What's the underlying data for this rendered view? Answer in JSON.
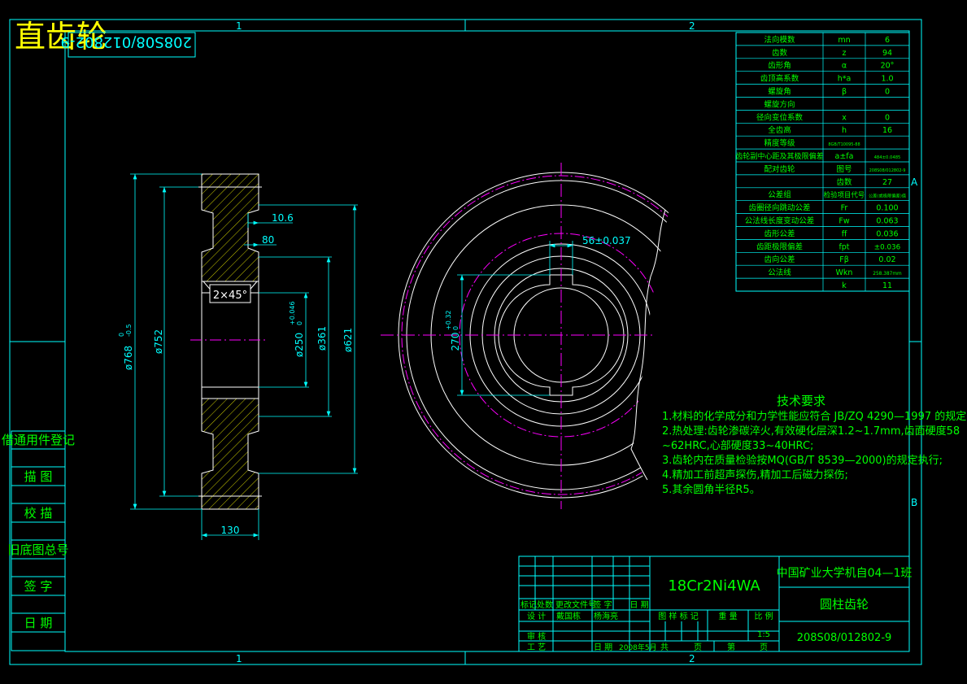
{
  "drawing": {
    "title_text": "直齿轮",
    "drawing_number_rotated": "208S08/012802-9",
    "zone_labels": {
      "col1": "1",
      "col2": "2",
      "rowA": "A",
      "rowB": "B"
    }
  },
  "colors": {
    "frame": "#00ffff",
    "geometry": "#ffffff",
    "center": "#ff00ff",
    "dimension": "#00ffff",
    "hatch": "#ffff00",
    "text_green": "#00ff00",
    "title": "#ffff00"
  },
  "side_panel": {
    "items": [
      "借通用件登记",
      "描 图",
      "校 描",
      "旧底图总号",
      "签 字",
      "日 期"
    ]
  },
  "dimensions": {
    "d_tip": "ø768",
    "d_tip_tol_upper": "0",
    "d_tip_tol_lower": "-0.5",
    "d_root": "ø752",
    "d_bore": "ø250",
    "d_bore_tol_upper": "+0.046",
    "d_bore_tol_lower": "0",
    "d_hub": "ø361",
    "d_web": "ø621",
    "width": "130",
    "groove_10": "10.6",
    "groove_80": "80",
    "chamfer": "2×45°",
    "keyway_width": "56±0.037",
    "keyway_depth": "270",
    "keyway_depth_tol_upper": "+0.32",
    "keyway_depth_tol_lower": "0"
  },
  "param_table": {
    "rows": [
      [
        "法向模数",
        "mn",
        "6"
      ],
      [
        "齿数",
        "z",
        "94"
      ],
      [
        "齿形角",
        "α",
        "20°"
      ],
      [
        "齿顶高系数",
        "h*a",
        "1.0"
      ],
      [
        "螺旋角",
        "β",
        "0"
      ],
      [
        "螺旋方向",
        "",
        ""
      ],
      [
        "径向变位系数",
        "x",
        "0"
      ],
      [
        "全齿高",
        "h",
        "16"
      ],
      [
        "精度等级",
        "8GB/T10095-88",
        ""
      ],
      [
        "齿轮副中心距及其极限偏差",
        "a±fa",
        "484±0.0485"
      ],
      [
        "配对齿轮",
        "图号",
        "208S08/012802-9"
      ],
      [
        "",
        "齿数",
        "27"
      ],
      [
        "公差组",
        "检验项目代号",
        "公差(或极限偏差)值"
      ],
      [
        "齿圈径向跳动公差",
        "Fr",
        "0.100"
      ],
      [
        "公法线长度变动公差",
        "Fw",
        "0.063"
      ],
      [
        "齿形公差",
        "ff",
        "0.036"
      ],
      [
        "齿距极限偏差",
        "fpt",
        "±0.036"
      ],
      [
        "齿向公差",
        "Fβ",
        "0.02"
      ],
      [
        "公法线",
        "Wkn",
        "258.387mm"
      ],
      [
        "",
        "k",
        "11"
      ]
    ]
  },
  "tech_requirements": {
    "title": "技术要求",
    "lines": [
      "1.材料的化学成分和力学性能应符合 JB/ZQ 4290—1997 的规定;",
      "2.热处理:齿轮渗碳淬火,有效硬化层深1.2~1.7mm,齿面硬度58",
      "  ~62HRC,心部硬度33~40HRC;",
      "3.齿轮内在质量检验按MQ(GB/T 8539—2000)的规定执行;",
      "4.精加工前超声探伤,精加工后磁力探伤;",
      "5.其余圆角半径R5。"
    ]
  },
  "title_block": {
    "material": "18Cr2Ni4WA",
    "school": "中国矿业大学机自04—1班",
    "part_name": "圆柱齿轮",
    "drawing_number": "208S08/012802-9",
    "scale_value": "1:5",
    "header_labels": [
      "标记",
      "处数",
      "更改文件号",
      "签 字",
      "日 期"
    ],
    "stage_labels": [
      "图 样 标 记",
      "重 量",
      "比 例"
    ],
    "left_rows": [
      "设 计",
      "审 核",
      "工 艺"
    ],
    "designer": "戴国栋",
    "designer2": "杨海亮",
    "date_label": "日 期",
    "date_value": "2008年5月",
    "sheet_total": "共",
    "sheet_unit1": "页",
    "sheet_no": "第",
    "sheet_unit2": "页"
  }
}
